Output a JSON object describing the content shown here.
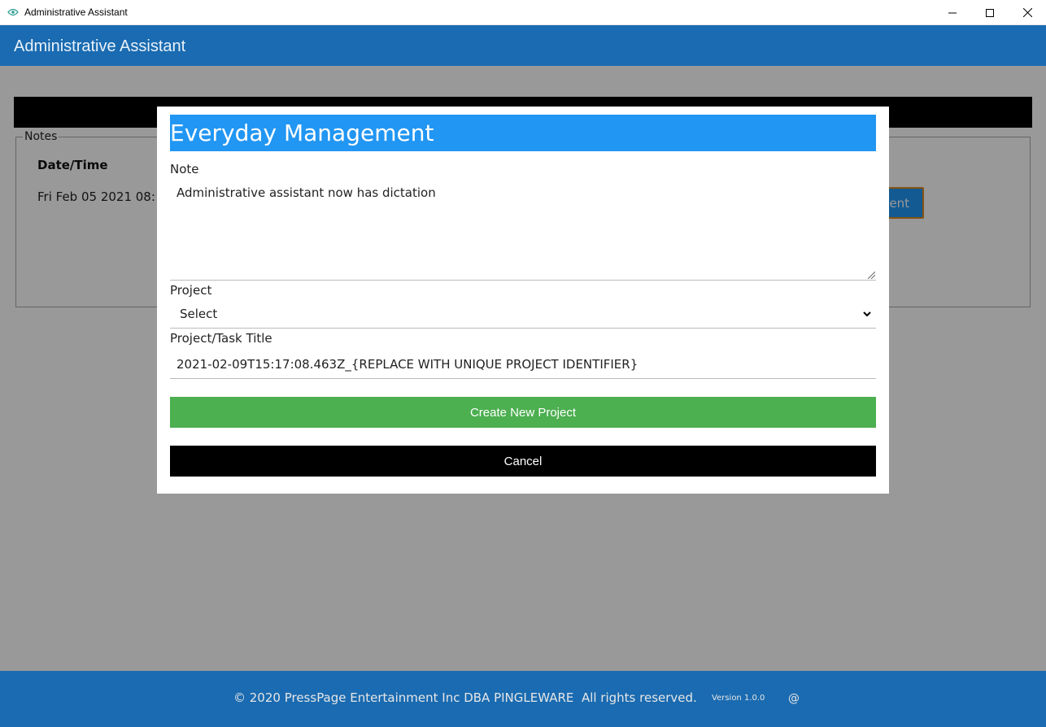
{
  "window": {
    "title": "Administrative Assistant",
    "minimize_icon": "minimize-icon",
    "maximize_icon": "maximize-icon",
    "close_icon": "close-icon"
  },
  "header": {
    "title": "Administrative Assistant",
    "bg_color": "#1a6bb1"
  },
  "background": {
    "notes_legend": "Notes",
    "column_header": "Date/Time",
    "row_date": "Fri Feb 05 2021 08:",
    "button_partial_label": "ent"
  },
  "modal": {
    "title": "Everyday Management",
    "note_label": "Note",
    "note_value": "Administrative assistant now has dictation",
    "project_label": "Project",
    "project_selected": "Select",
    "task_title_label": "Project/Task Title",
    "task_title_value": "2021-02-09T15:17:08.463Z_{REPLACE WITH UNIQUE PROJECT IDENTIFIER}",
    "create_label": "Create New Project",
    "cancel_label": "Cancel",
    "title_bg": "#2196f3",
    "create_bg": "#4caf50",
    "cancel_bg": "#000000"
  },
  "footer": {
    "copyright": "© 2020 PressPage Entertainment Inc DBA PINGLEWARE  All rights reserved.",
    "version": "Version 1.0.0",
    "at": "@"
  }
}
